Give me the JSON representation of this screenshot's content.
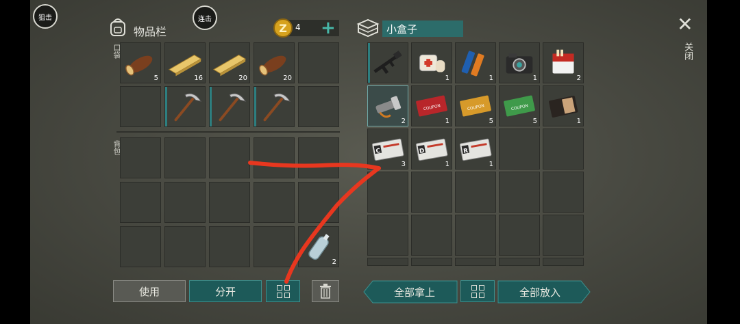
{
  "buttons": {
    "snipe": "狙击",
    "combo": "连击",
    "use": "使用",
    "split": "分开",
    "take_all": "全部拿上",
    "put_all": "全部放入",
    "close": "关闭"
  },
  "inventory": {
    "title": "物品栏",
    "coins": "4",
    "pocket_label": "口袋",
    "backpack_label": "背包",
    "pocket_slots": [
      {
        "item": "log",
        "qty": "5"
      },
      {
        "item": "plank",
        "qty": "16"
      },
      {
        "item": "plank",
        "qty": "20"
      },
      {
        "item": "log",
        "qty": "20"
      },
      {
        "item": "",
        "qty": ""
      },
      {
        "item": "",
        "qty": ""
      },
      {
        "item": "pickaxe",
        "qty": ""
      },
      {
        "item": "pickaxe",
        "qty": ""
      },
      {
        "item": "pickaxe",
        "qty": ""
      },
      {
        "item": "",
        "qty": ""
      }
    ],
    "backpack_slots": [
      {
        "item": "",
        "qty": ""
      },
      {
        "item": "",
        "qty": ""
      },
      {
        "item": "",
        "qty": ""
      },
      {
        "item": "",
        "qty": ""
      },
      {
        "item": "",
        "qty": ""
      },
      {
        "item": "",
        "qty": ""
      },
      {
        "item": "",
        "qty": ""
      },
      {
        "item": "",
        "qty": ""
      },
      {
        "item": "",
        "qty": ""
      },
      {
        "item": "",
        "qty": ""
      },
      {
        "item": "",
        "qty": ""
      },
      {
        "item": "",
        "qty": ""
      },
      {
        "item": "",
        "qty": ""
      },
      {
        "item": "",
        "qty": ""
      },
      {
        "item": "water-bottle",
        "qty": "2"
      }
    ]
  },
  "container": {
    "title": "小盒子",
    "slots": [
      {
        "item": "rifle",
        "qty": ""
      },
      {
        "item": "bandage",
        "qty": "1"
      },
      {
        "item": "batteries",
        "qty": "1"
      },
      {
        "item": "camera",
        "qty": "1"
      },
      {
        "item": "cigarettes",
        "qty": "2"
      },
      {
        "item": "flashlight",
        "qty": "2"
      },
      {
        "item": "coupon-red",
        "qty": "1"
      },
      {
        "item": "coupon-gold",
        "qty": "5"
      },
      {
        "item": "coupon-green",
        "qty": "5"
      },
      {
        "item": "wallet",
        "qty": "1"
      },
      {
        "item": "keycard-c",
        "qty": "3"
      },
      {
        "item": "keycard-d",
        "qty": "1"
      },
      {
        "item": "keycard-r",
        "qty": "1"
      },
      {
        "item": "",
        "qty": ""
      },
      {
        "item": "",
        "qty": ""
      }
    ],
    "keycard_letters": {
      "c": "C",
      "d": "D",
      "r": "R"
    }
  },
  "annotation_color": "#e8371f"
}
